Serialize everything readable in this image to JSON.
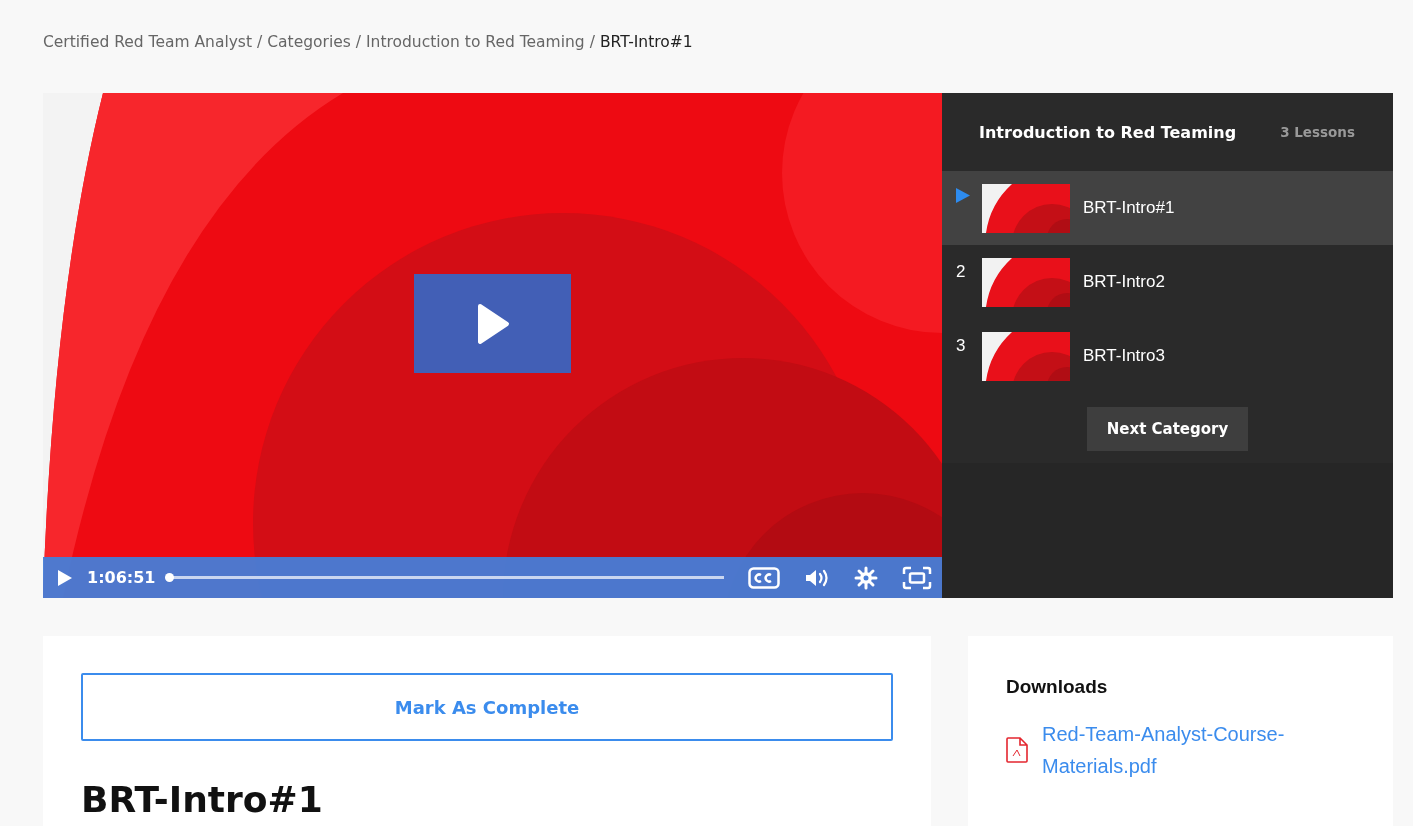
{
  "breadcrumb_separator": "/",
  "breadcrumb": [
    {
      "label": "Certified Red Team Analyst",
      "current": false
    },
    {
      "label": "Categories",
      "current": false
    },
    {
      "label": "Introduction to Red Teaming",
      "current": false
    },
    {
      "label": "BRT-Intro#1",
      "current": true
    }
  ],
  "video": {
    "kind": "picture",
    "time": "1:06:51",
    "level": 0
  },
  "sidebar": {
    "title": "Introduction to Red Teaming",
    "count": "3 Lessons",
    "lessons": [
      {
        "title": "BRT-Intro#1",
        "selected": true
      },
      {
        "number": "2",
        "title": "BRT-Intro2",
        "selected": false
      },
      {
        "number": "3",
        "title": "BRT-Intro3",
        "selected": false
      }
    ],
    "next_button": "Next Category"
  },
  "lesson": {
    "complete_button": "Mark As Complete",
    "title": "BRT-Intro#1"
  },
  "downloads": {
    "title": "Downloads",
    "files": [
      "Red-Team-Analyst-Course-Materials.pdf"
    ]
  }
}
